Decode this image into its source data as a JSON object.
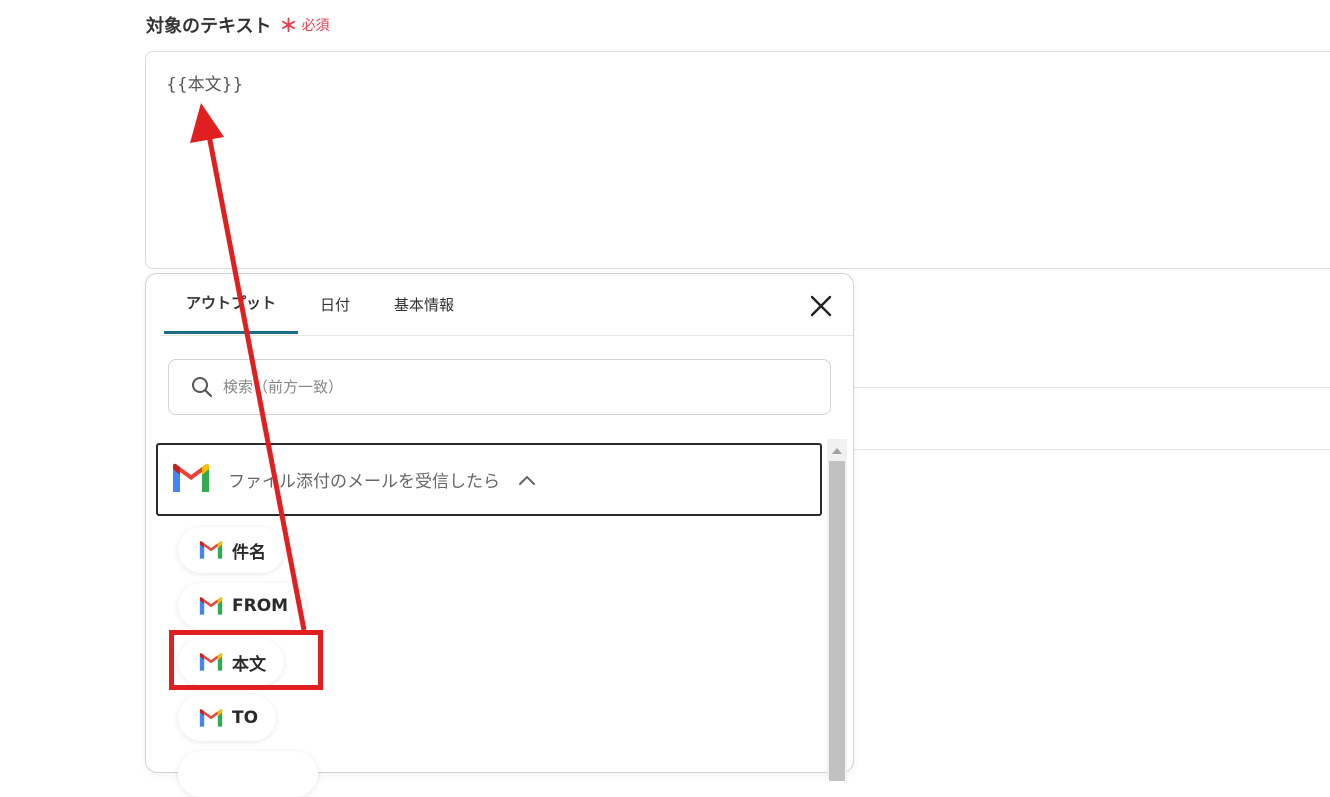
{
  "field": {
    "label": "対象のテキスト",
    "required_mark": "＊",
    "required_text": "必須",
    "value": "{{本文}}"
  },
  "panel": {
    "tabs": [
      {
        "label": "アウトプット",
        "active": true
      },
      {
        "label": "日付",
        "active": false
      },
      {
        "label": "基本情報",
        "active": false
      }
    ],
    "search_placeholder": "検索（前方一致）",
    "group": {
      "title": "ファイル添付のメールを受信したら",
      "icon": "gmail-icon",
      "expanded": true
    },
    "items": [
      {
        "label": "件名",
        "icon": "gmail-icon"
      },
      {
        "label": "FROM",
        "icon": "gmail-icon"
      },
      {
        "label": "本文",
        "icon": "gmail-icon",
        "highlighted": true
      },
      {
        "label": "TO",
        "icon": "gmail-icon"
      }
    ]
  },
  "annotation": {
    "highlight_color": "#e02020",
    "arrow": "from-本文-to-field"
  },
  "colors": {
    "required": "#e8414f",
    "active_tab_underline": "#1b6d8a",
    "annotation": "#e02020"
  }
}
